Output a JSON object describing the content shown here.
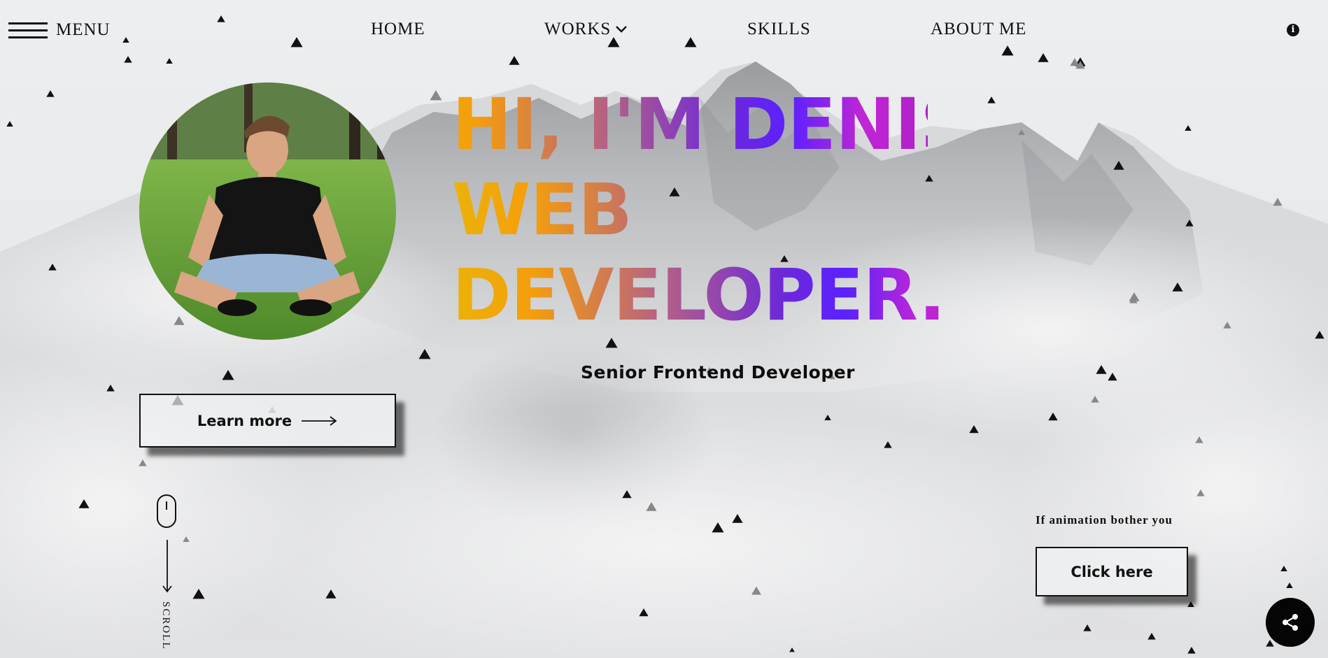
{
  "header": {
    "menu_label": "MENU",
    "nav": {
      "home": "HOME",
      "works": "WORKS",
      "skills": "SKILLS",
      "about": "ABOUT ME"
    },
    "info_icon": "i"
  },
  "hero": {
    "headline_line1": "HI, I'M DENIS,",
    "headline_line2": "WEB",
    "headline_line3": "DEVELOPER.",
    "subtitle": "Senior Frontend Developer",
    "learn_more_label": "Learn more",
    "scroll_label": "SCROLL"
  },
  "animation_toggle": {
    "note": "If animation bother you",
    "button_label": "Click here"
  },
  "icons": {
    "menu": "hamburger-menu-icon",
    "works_dropdown": "chevron-down-icon",
    "info": "info-icon",
    "learn_more_arrow": "arrow-right-icon",
    "mouse": "mouse-icon",
    "scroll_arrow": "arrow-down-icon",
    "share": "share-icon"
  },
  "colors": {
    "gradient_start": "#eab308",
    "gradient_mid": "#6d28d9",
    "gradient_end": "#c026d3",
    "text": "#111111",
    "background": "#e9eaec"
  }
}
